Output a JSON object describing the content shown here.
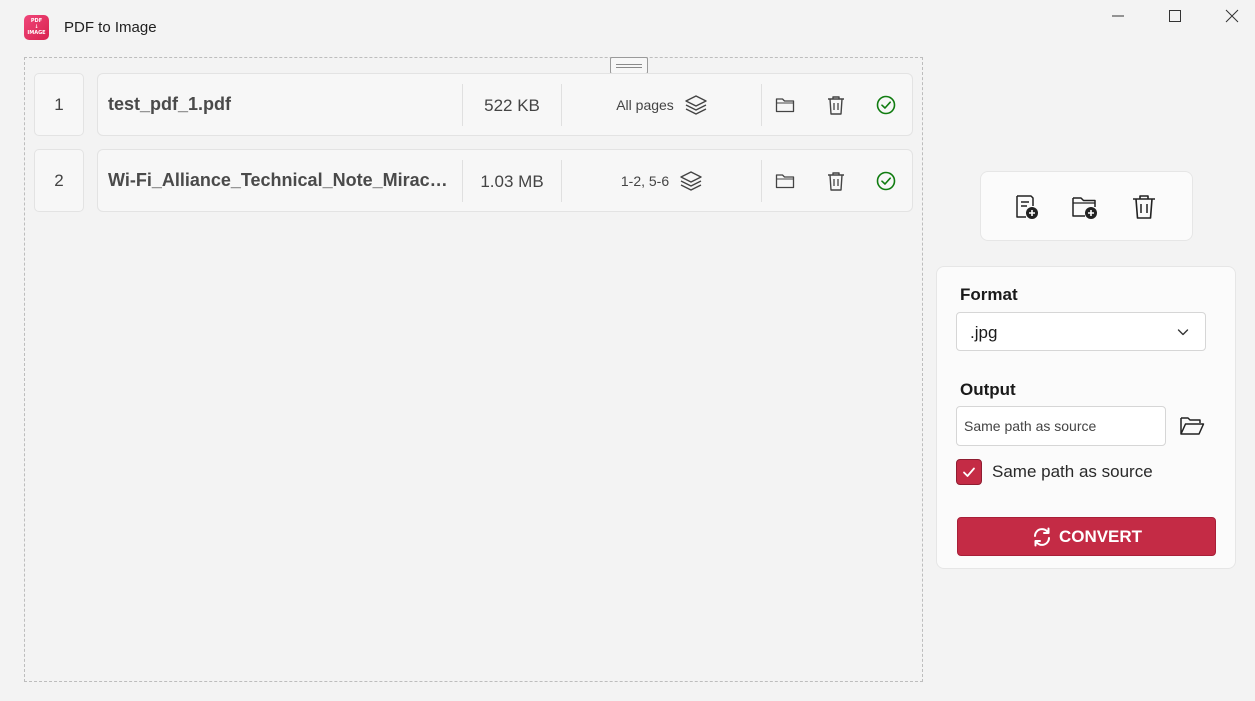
{
  "app": {
    "title": "PDF to Image",
    "icon_text": "PDF → IMAGE",
    "brand_color": "#c42b45"
  },
  "window_controls": [
    "minimize-icon",
    "maximize-icon",
    "close-icon"
  ],
  "files": [
    {
      "index": "1",
      "name": "test_pdf_1.pdf",
      "size": "522 KB",
      "pages": "All pages",
      "status": "done"
    },
    {
      "index": "2",
      "name": "Wi-Fi_Alliance_Technical_Note_Miracast_Over_Infrastructure.pdf",
      "size": "1.03 MB",
      "pages": "1-2, 5-6",
      "status": "done"
    }
  ],
  "toolbar": {
    "actions": [
      "add-file-icon",
      "add-folder-icon",
      "clear-all-icon"
    ]
  },
  "settings": {
    "format_label": "Format",
    "format_value": ".jpg",
    "output_label": "Output",
    "output_placeholder": "Same path as source",
    "same_path_checked": true,
    "same_path_label": "Same path as source",
    "convert_label": "CONVERT"
  }
}
